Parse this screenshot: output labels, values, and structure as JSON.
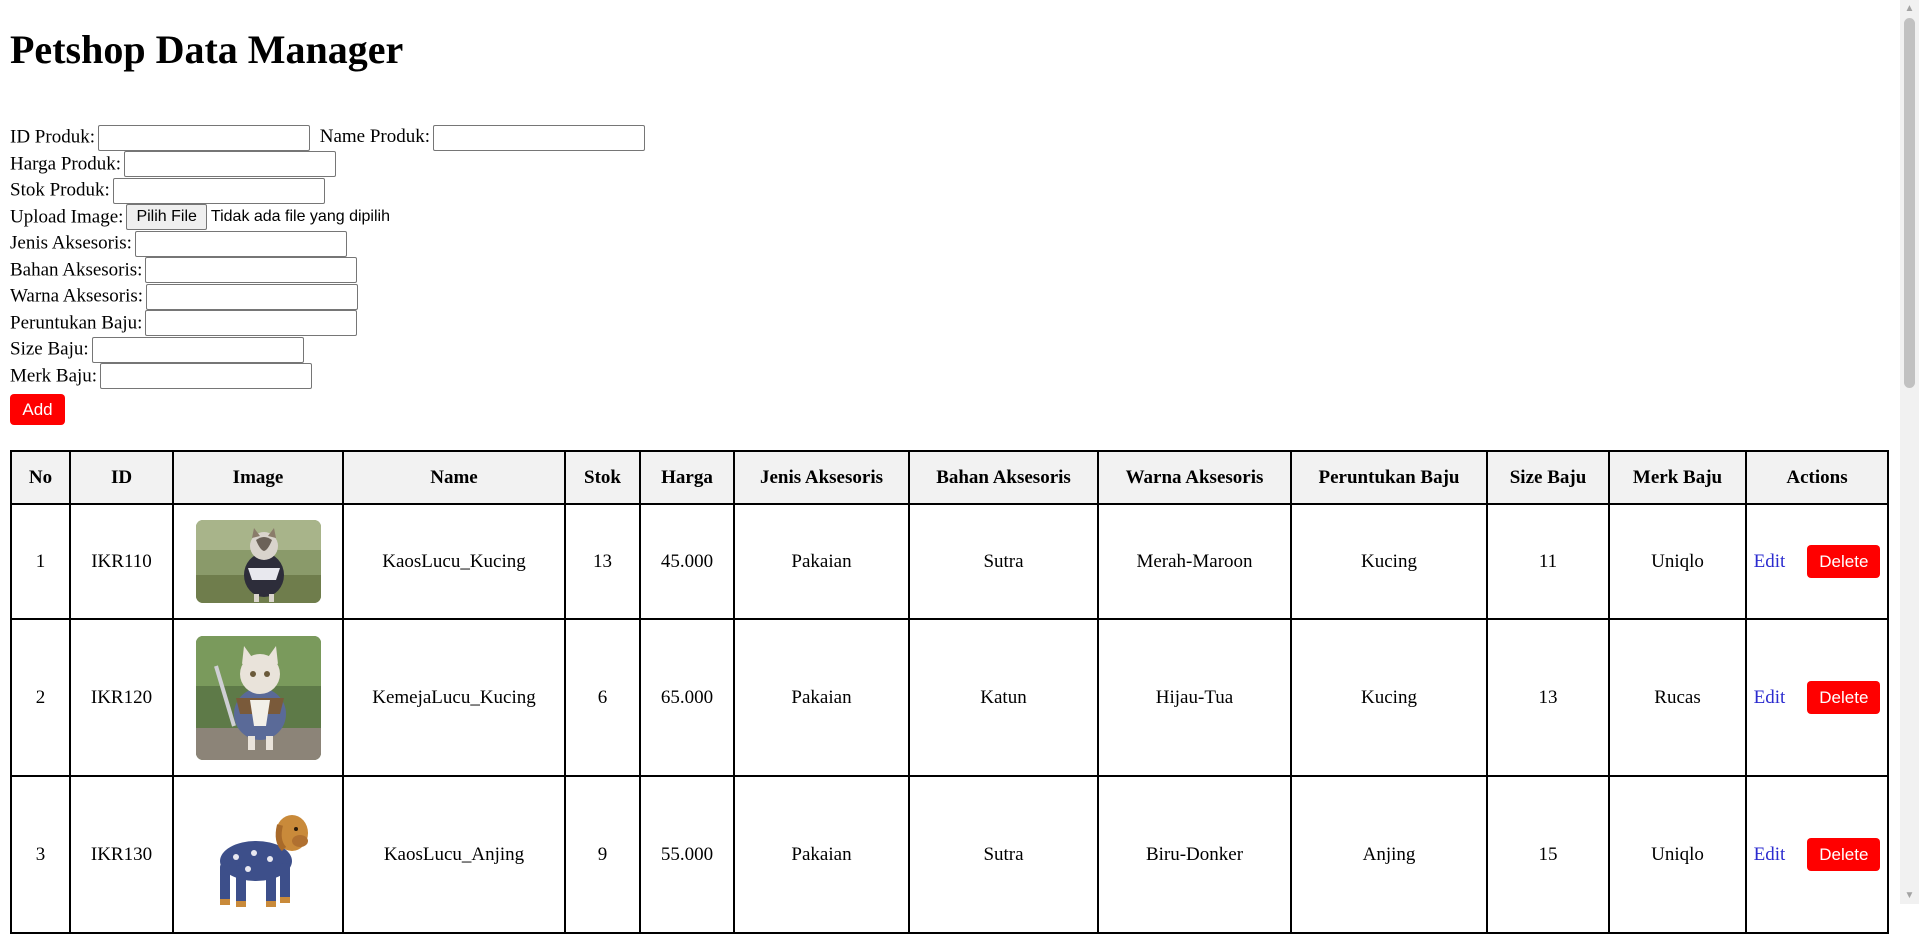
{
  "title": "Petshop Data Manager",
  "form": {
    "fields": {
      "id": "ID Produk:",
      "name": "Name Produk:",
      "harga": "Harga Produk:",
      "stok": "Stok Produk:",
      "image": "Upload Image:",
      "jenis": "Jenis Aksesoris:",
      "bahan": "Bahan Aksesoris:",
      "warna": "Warna Aksesoris:",
      "peruntukan": "Peruntukan Baju:",
      "size": "Size Baju:",
      "merk": "Merk Baju:"
    },
    "file_button": "Pilih File",
    "file_status": "Tidak ada file yang dipilih",
    "add_button": "Add"
  },
  "table": {
    "headers": [
      "No",
      "ID",
      "Image",
      "Name",
      "Stok",
      "Harga",
      "Jenis Aksesoris",
      "Bahan Aksesoris",
      "Warna Aksesoris",
      "Peruntukan Baju",
      "Size Baju",
      "Merk Baju",
      "Actions"
    ],
    "rows": [
      {
        "no": "1",
        "id": "IKR110",
        "image_icon": "cat-in-dress-photo",
        "name": "KaosLucu_Kucing",
        "stok": "13",
        "harga": "45.000",
        "jenis": "Pakaian",
        "bahan": "Sutra",
        "warna": "Merah-Maroon",
        "peruntukan": "Kucing",
        "size": "11",
        "merk": "Uniqlo",
        "edit": "Edit",
        "delete": "Delete"
      },
      {
        "no": "2",
        "id": "IKR120",
        "image_icon": "cat-in-costume-photo",
        "name": "KemejaLucu_Kucing",
        "stok": "6",
        "harga": "65.000",
        "jenis": "Pakaian",
        "bahan": "Katun",
        "warna": "Hijau-Tua",
        "peruntukan": "Kucing",
        "size": "13",
        "merk": "Rucas",
        "edit": "Edit",
        "delete": "Delete"
      },
      {
        "no": "3",
        "id": "IKR130",
        "image_icon": "dog-in-pajamas-photo",
        "name": "KaosLucu_Anjing",
        "stok": "9",
        "harga": "55.000",
        "jenis": "Pakaian",
        "bahan": "Sutra",
        "warna": "Biru-Donker",
        "peruntukan": "Anjing",
        "size": "15",
        "merk": "Uniqlo",
        "edit": "Edit",
        "delete": "Delete"
      }
    ]
  },
  "colors": {
    "accent": "#ff0000",
    "link": "#2b2bcf",
    "header_bg": "#f2f2f2"
  }
}
